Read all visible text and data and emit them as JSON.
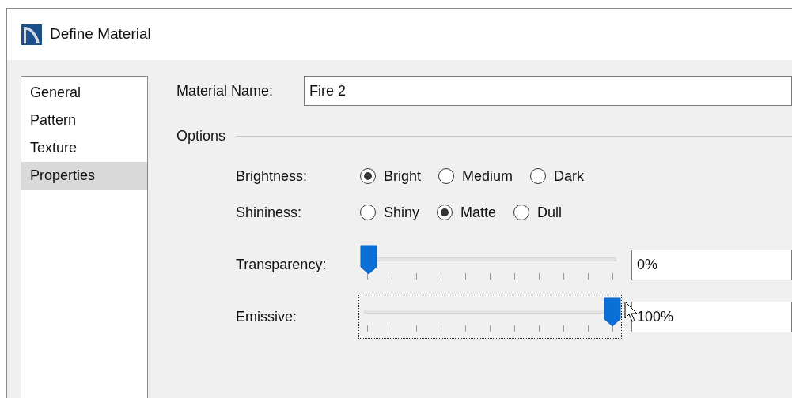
{
  "window": {
    "title": "Define Material"
  },
  "sidebar": {
    "items": [
      {
        "label": "General",
        "selected": false
      },
      {
        "label": "Pattern",
        "selected": false
      },
      {
        "label": "Texture",
        "selected": false
      },
      {
        "label": "Properties",
        "selected": true
      }
    ]
  },
  "material_name": {
    "label": "Material Name:",
    "value": "Fire 2"
  },
  "options": {
    "title": "Options",
    "radio_groups": [
      {
        "label": "Brightness:",
        "options": [
          {
            "label": "Bright",
            "selected": true
          },
          {
            "label": "Medium",
            "selected": false
          },
          {
            "label": "Dark",
            "selected": false
          }
        ]
      },
      {
        "label": "Shininess:",
        "options": [
          {
            "label": "Shiny",
            "selected": false
          },
          {
            "label": "Matte",
            "selected": true
          },
          {
            "label": "Dull",
            "selected": false
          }
        ]
      }
    ],
    "sliders": [
      {
        "label": "Transparency:",
        "level": 0,
        "value": "0%",
        "focused": false
      },
      {
        "label": "Emissive:",
        "level": 1,
        "value": "100%",
        "focused": true
      }
    ]
  }
}
